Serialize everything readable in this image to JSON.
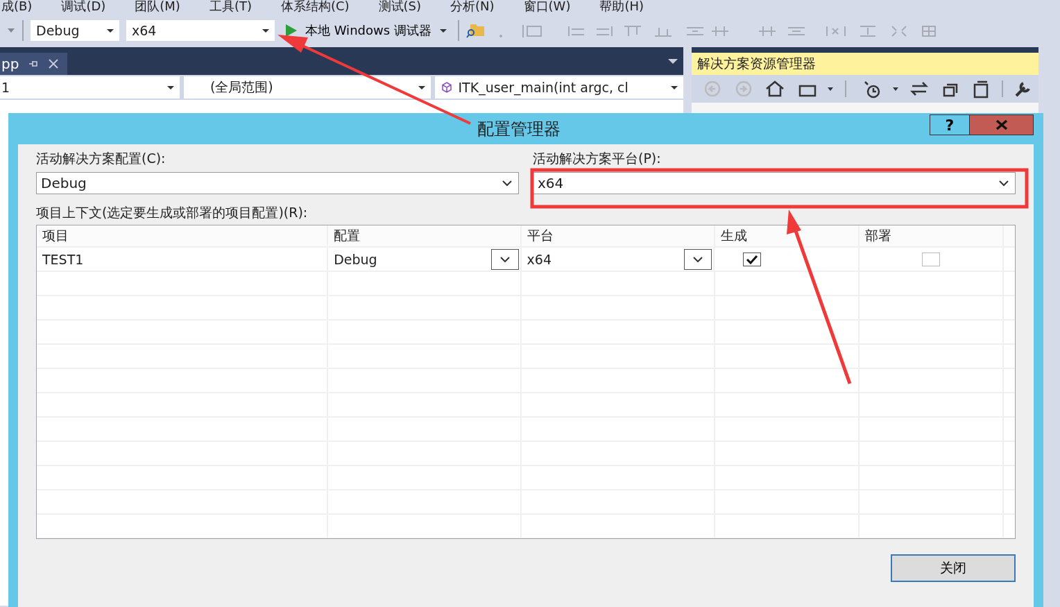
{
  "menu": [
    "成(B)",
    "调试(D)",
    "团队(M)",
    "工具(T)",
    "体系结构(C)",
    "测试(S)",
    "分析(N)",
    "窗口(W)",
    "帮助(H)"
  ],
  "toolbar": {
    "configuration": "Debug",
    "platform": "x64",
    "run_label": "本地 Windows 调试器"
  },
  "editor": {
    "tab": "pp",
    "nav": [
      "1",
      "(全局范围)",
      "ITK_user_main(int argc, cl"
    ]
  },
  "solution_explorer": {
    "title": "解决方案资源管理器"
  },
  "dialog": {
    "title": "配置管理器",
    "help": "?",
    "config_label": "活动解决方案配置(C):",
    "config_value": "Debug",
    "platform_label": "活动解决方案平台(P):",
    "platform_value": "x64",
    "context_label": "项目上下文(选定要生成或部署的项目配置)(R):",
    "columns": [
      "项目",
      "配置",
      "平台",
      "生成",
      "部署"
    ],
    "rows": [
      {
        "project": "TEST1",
        "configuration": "Debug",
        "platform": "x64",
        "build": true,
        "deploy": false
      }
    ],
    "close_button": "关闭"
  }
}
